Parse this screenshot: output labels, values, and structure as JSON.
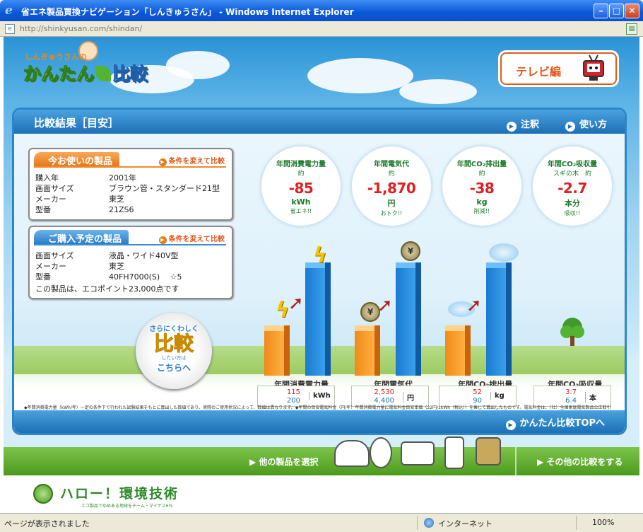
{
  "window": {
    "title": "省エネ製品買換ナビゲーション「しんきゅうさん」 - Windows Internet Explorer",
    "minimize": "–",
    "maximize": "□",
    "close": "✕"
  },
  "address": {
    "url": "http://shinkyusan.com/shindan/"
  },
  "header": {
    "logo_sub": "しんきゅうさんの",
    "logo_main_a": "かんたん",
    "logo_main_b": "比較",
    "tv_button": "テレビ編"
  },
  "panel": {
    "title": "比較結果［目安］",
    "notes_link": "注釈",
    "howto_link": "使い方",
    "top_link": "かんたん比較TOPへ"
  },
  "current_product": {
    "title": "今お使いの製品",
    "change": "条件を変えて比較",
    "rows": [
      {
        "k": "購入年",
        "v": "2001年"
      },
      {
        "k": "画面サイズ",
        "v": "ブラウン管・スタンダード21型"
      },
      {
        "k": "メーカー",
        "v": "東芝"
      },
      {
        "k": "型番",
        "v": "21ZS6"
      }
    ]
  },
  "planned_product": {
    "title": "ご購入予定の製品",
    "change": "条件を変えて比較",
    "rows": [
      {
        "k": "画面サイズ",
        "v": "液晶・ワイド40V型"
      },
      {
        "k": "メーカー",
        "v": "東芝"
      },
      {
        "k": "型番",
        "v": "40FH7000(S)　 ☆5"
      }
    ],
    "eco_point": "この製品は、エコポイント23,000点です"
  },
  "stats": [
    {
      "title": "年間消費電力量",
      "approx": "約",
      "value": "-85",
      "unit": "kWh",
      "note": "省エネ!!"
    },
    {
      "title": "年間電気代",
      "approx": "約",
      "value": "-1,870",
      "unit": "円",
      "note": "おトク!!"
    },
    {
      "title": "年間CO₂排出量",
      "approx": "約",
      "value": "-38",
      "unit": "kg",
      "note": "削減!!"
    },
    {
      "title": "年間CO₂吸収量",
      "approx": "スギの木　約",
      "value": "-2.7",
      "unit": "本分",
      "note": "吸収!!"
    }
  ],
  "chart_data": [
    {
      "type": "bar",
      "title": "年間消費電力量",
      "categories": [
        "今お使いの製品",
        "ご購入予定の製品"
      ],
      "values": [
        200,
        115
      ],
      "unit": "kWh"
    },
    {
      "type": "bar",
      "title": "年間電気代",
      "categories": [
        "今お使いの製品",
        "ご購入予定の製品"
      ],
      "values": [
        4400,
        2530
      ],
      "unit": "円"
    },
    {
      "type": "bar",
      "title": "年間CO₂排出量",
      "categories": [
        "今お使いの製品",
        "ご購入予定の製品"
      ],
      "values": [
        90,
        52
      ],
      "unit": "kg"
    },
    {
      "type": "table",
      "title": "年間CO₂吸収量",
      "categories": [
        "今お使いの製品",
        "ご購入予定の製品"
      ],
      "values": [
        6.4,
        3.7
      ],
      "unit": "本"
    }
  ],
  "value_boxes": [
    {
      "new": "115",
      "old": "200",
      "unit": "kWh"
    },
    {
      "new": "2,530",
      "old": "4,400",
      "unit": "円"
    },
    {
      "new": "52",
      "old": "90",
      "unit": "kg"
    },
    {
      "new": "3.7",
      "old": "6.4",
      "unit": "本"
    }
  ],
  "again": {
    "top": "さらにくわしく",
    "big": "比較",
    "small": "したい方は",
    "bottom": "こちらへ"
  },
  "footnote": "◆年間消費電力量（kWh/年）一定の条件下で行われた試験結果をもとに算出した数値であり、実際のご使用状況によって、数値は異なります。◆年間の目安電気料金（円/年）年間消費電力量に電気料金目安単価（22円/1kWh（税込））を乗じて算出したものです。電気料金は、（社）全国家庭電気製品公正取引協議会　新電力料金目安単価を引用しておりますが、各ご家庭の使用環境や電力会社等によって異なります。◆年間CO2排出量（kg）年間消費電力量にCO2排出係数（0.453kg/1kWh）を乗じて算出したものです。【電気事業連合会　「電気事業における環境行動計画(2008)」】◆CO2吸収量（本）50年生の杉1本につき、年間平均約14kgCO2を吸収するものとして算出しています。【環境省/林野庁　「地球温暖化防止のための緑の吸収源対策」 平成14年】◆一般的に大画面で多機能になるほど、消費電力も大きくなりますが、同じ画面サイズの製品を比較する場合は、むしろいものほど消費電力が少なくなっています。",
  "nav": {
    "select_other": "▶ 他の製品を選択",
    "compare_other": "▶ その他の比較をする"
  },
  "banner": {
    "text": "ハロー！環境技術",
    "sub": "エコ製品でゆめある地球をチーム・マイナス6％"
  },
  "status": {
    "text": "ページが表示されました",
    "zone": "インターネット",
    "zoom": "100%"
  }
}
